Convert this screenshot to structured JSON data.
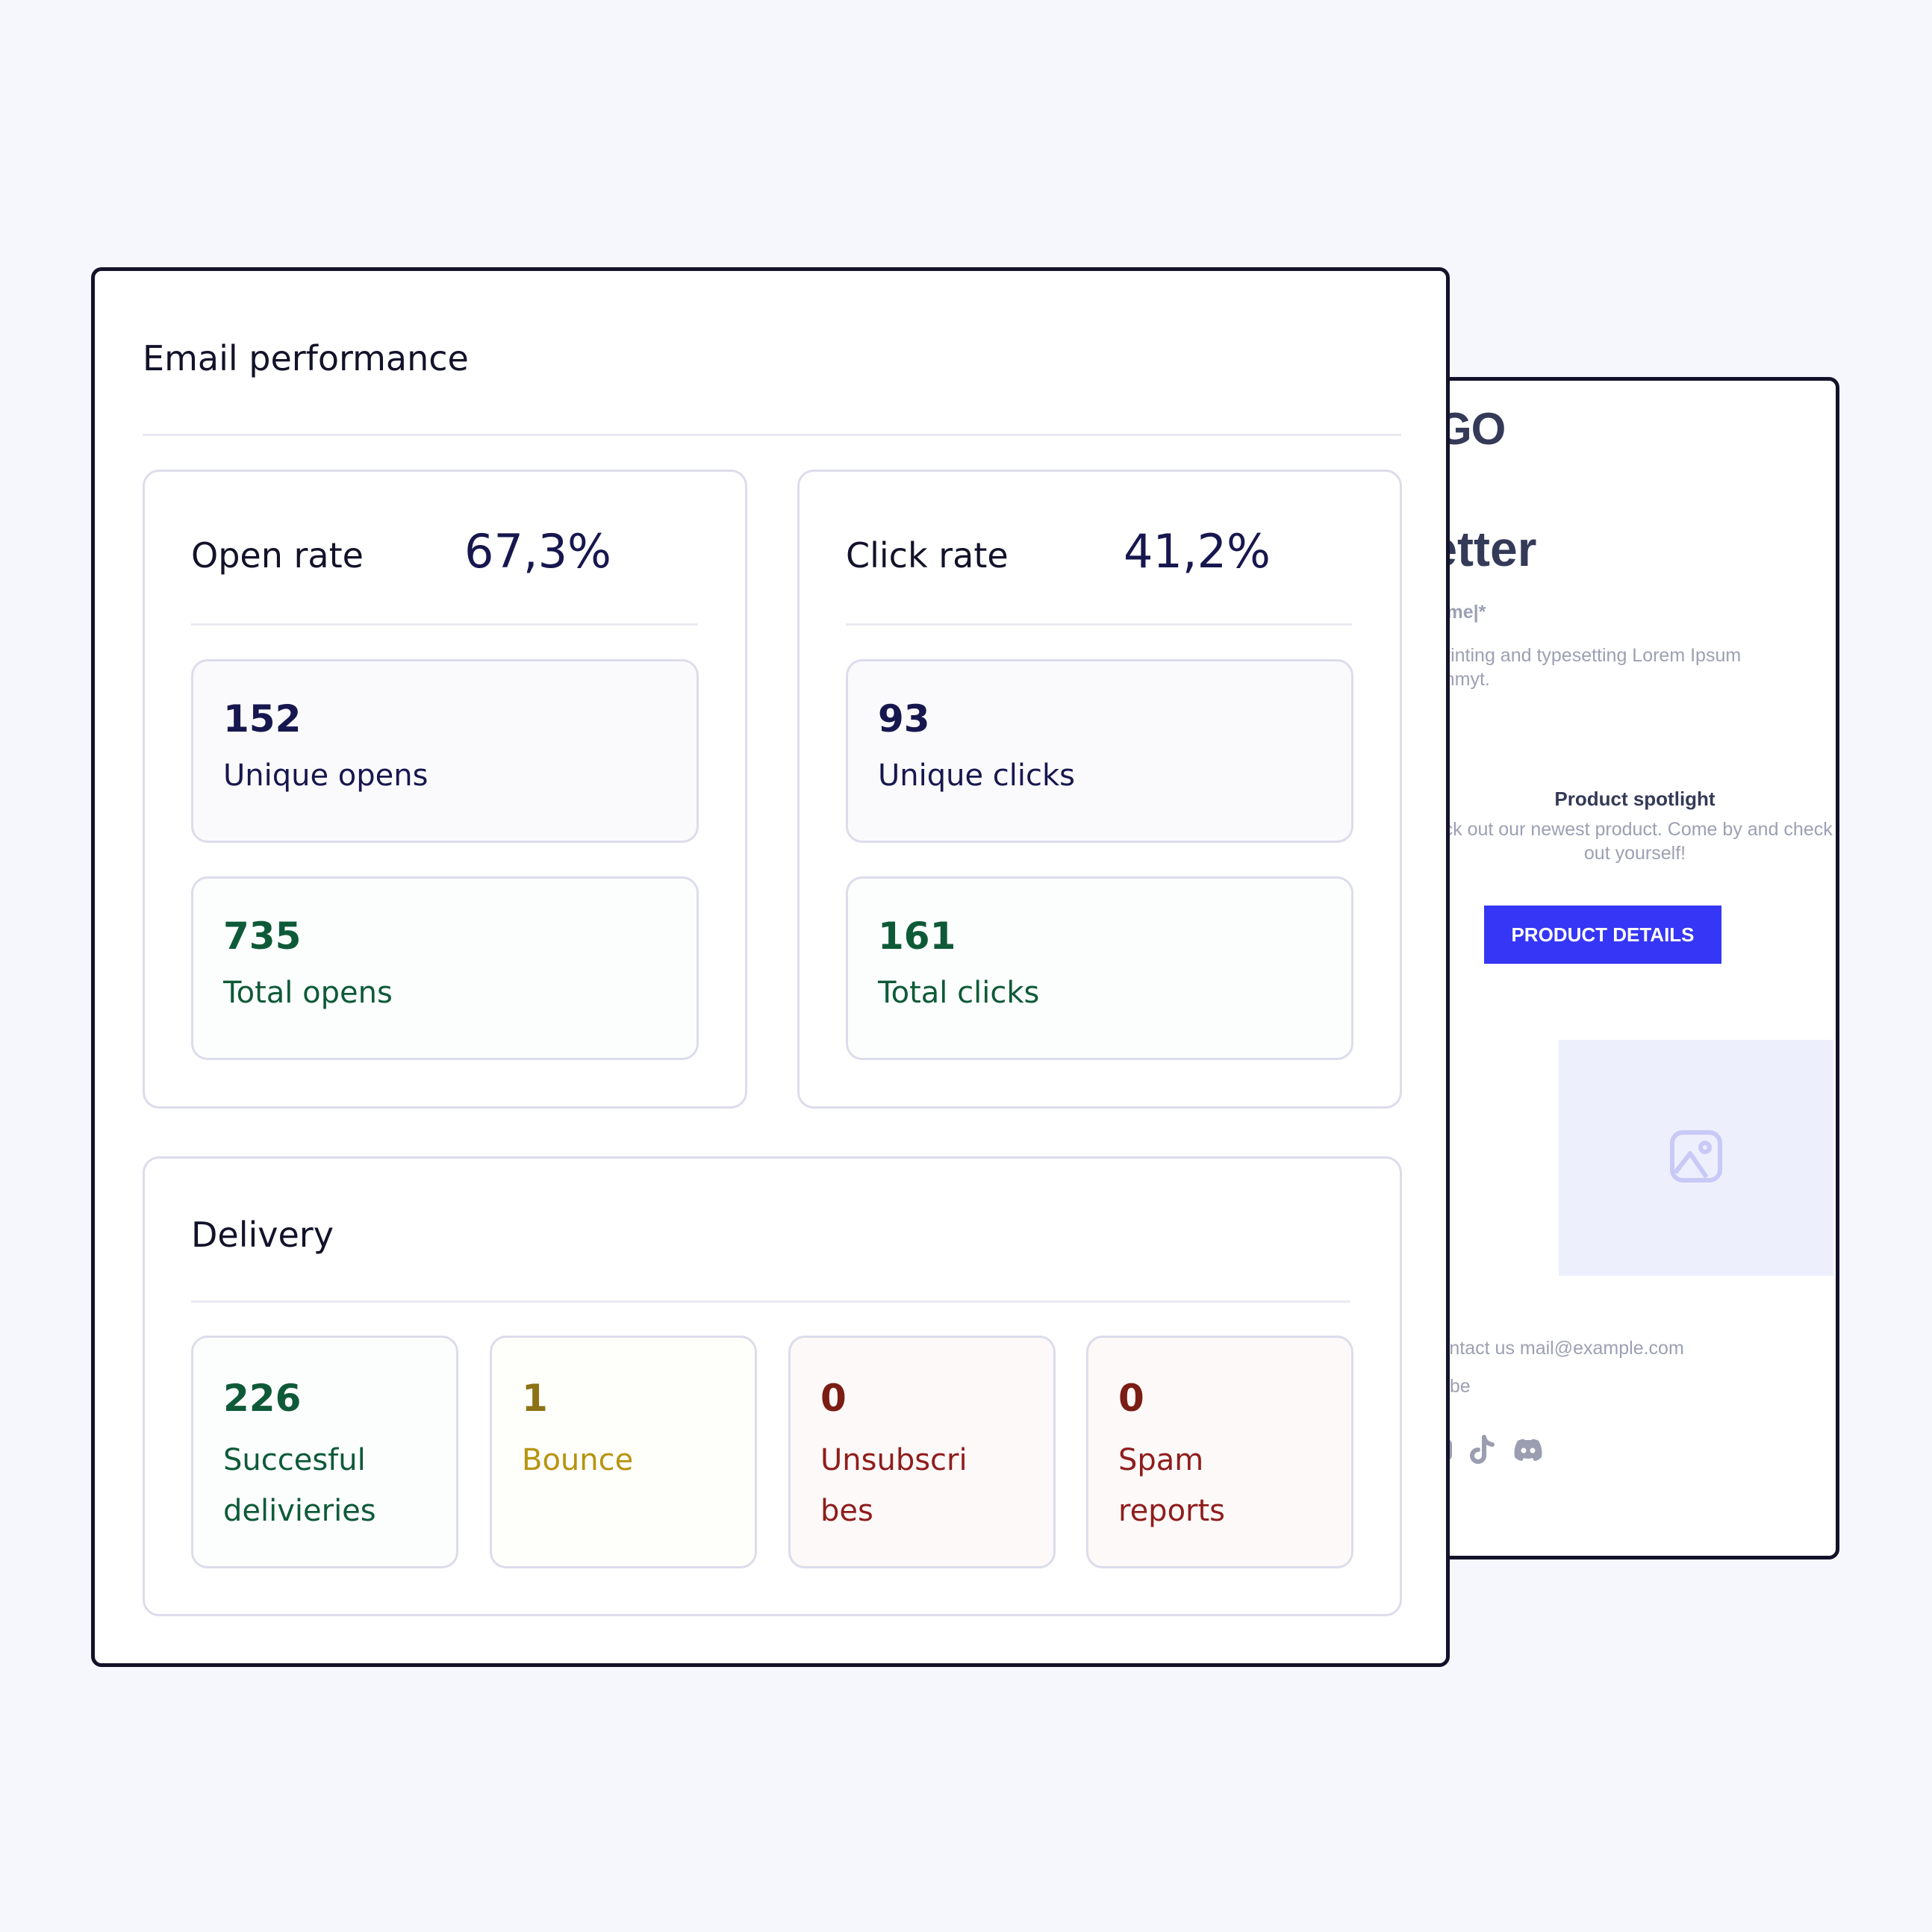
{
  "newsletter_preview": {
    "logo_text": "GO",
    "title": "letter",
    "name_placeholder": "tname|*",
    "intro_line1": "e printing and typesetting Lorem Ipsum",
    "intro_line2": "dummyt.",
    "spotlight_title": "Product spotlight",
    "spotlight_body": "heck out our newest product. Come by and check it out yourself!",
    "button_label": "PRODUCT DETAILS",
    "button_color": "#3636f7",
    "image_placeholder_icon": "image-icon",
    "contact_text": "contact us mail@example.com",
    "unsubscribe_text": "scribe",
    "social_icons": [
      "youtube-icon",
      "tiktok-icon",
      "discord-icon"
    ]
  },
  "email_performance": {
    "title": "Email performance",
    "open_rate": {
      "label": "Open rate",
      "value": "67,3%",
      "stats": [
        {
          "value": "152",
          "label": "Unique opens"
        },
        {
          "value": "735",
          "label": "Total opens"
        }
      ]
    },
    "click_rate": {
      "label": "Click rate",
      "value": "41,2%",
      "stats": [
        {
          "value": "93",
          "label": "Unique clicks"
        },
        {
          "value": "161",
          "label": "Total clicks"
        }
      ]
    },
    "delivery": {
      "title": "Delivery",
      "stats": [
        {
          "value": "226",
          "label": "Succesful delivieries"
        },
        {
          "value": "1",
          "label": "Bounce"
        },
        {
          "value": "0",
          "label": "Unsubscribes"
        },
        {
          "value": "0",
          "label": "Spam reports"
        }
      ]
    }
  },
  "colors": {
    "navy": "#17174f",
    "green": "#0e5a38",
    "gold": "#8d7215",
    "red": "#7a1d14",
    "background": "#f6f7fd"
  }
}
